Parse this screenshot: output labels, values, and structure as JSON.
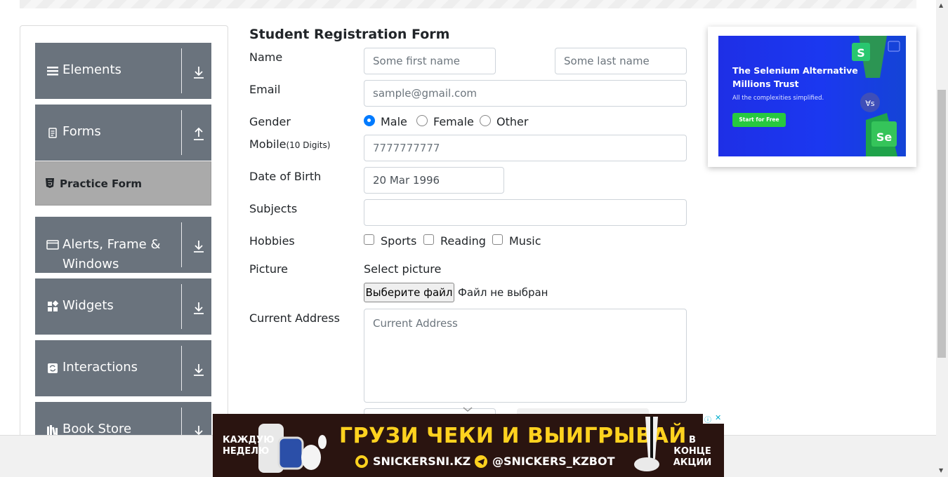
{
  "sidebar": {
    "groups": [
      {
        "label": "Elements",
        "icon": "hamburger-icon",
        "arrow": "download-arrow-icon"
      },
      {
        "label": "Forms",
        "icon": "form-icon",
        "arrow": "upload-arrow-icon"
      },
      {
        "label": "Alerts, Frame & Windows",
        "icon": "window-icon",
        "arrow": "download-arrow-icon"
      },
      {
        "label": "Widgets",
        "icon": "widgets-icon",
        "arrow": "download-arrow-icon"
      },
      {
        "label": "Interactions",
        "icon": "interactions-icon",
        "arrow": "download-arrow-icon"
      },
      {
        "label": "Book Store",
        "icon": "book-icon",
        "arrow": "download-arrow-icon"
      }
    ],
    "active_subitem": {
      "label": "Practice Form",
      "icon": "html5-icon"
    }
  },
  "form": {
    "title": "Student Registration Form",
    "name_label": "Name",
    "first_name_placeholder": "Some first name",
    "last_name_placeholder": "Some last name",
    "email_label": "Email",
    "email_placeholder": "sample@gmail.com",
    "gender_label": "Gender",
    "gender_options": [
      "Male",
      "Female",
      "Other"
    ],
    "gender_selected": "Male",
    "mobile_label": "Mobile",
    "mobile_hint": "(10 Digits)",
    "mobile_placeholder": "7777777777",
    "dob_label": "Date of Birth",
    "dob_value": "20 Mar 1996",
    "subjects_label": "Subjects",
    "subjects_value": "",
    "hobbies_label": "Hobbies",
    "hobbies_options": [
      "Sports",
      "Reading",
      "Music"
    ],
    "picture_label": "Picture",
    "select_picture": "Select picture",
    "file_button": "Выберите файл",
    "file_status": "Файл не выбран",
    "address_label": "Current Address",
    "address_placeholder": "Current Address"
  },
  "ad_right": {
    "title": "The Selenium Alternative Millions Trust",
    "subtitle": "All the complexities simplified.",
    "cta": "Start for Free",
    "colors": {
      "background": "#1b38f0",
      "cta": "#27c93f"
    }
  },
  "ad_bottom": {
    "left_text": "КАЖДУЮ НЕДЕЛЮ",
    "headline": "ГРУЗИ ЧЕКИ И ВЫИГРЫВАЙ",
    "site": "SNICKERSNI.KZ",
    "telegram": "@SNICKERS_KZBOT",
    "right_text": "В КОНЦЕ АКЦИИ",
    "colors": {
      "background": "#2a1410",
      "headline": "#ffd21f"
    }
  },
  "colors": {
    "sidebar_header": "#6a737d",
    "sidebar_active": "#aaaaaa",
    "accent": "#007bff"
  }
}
